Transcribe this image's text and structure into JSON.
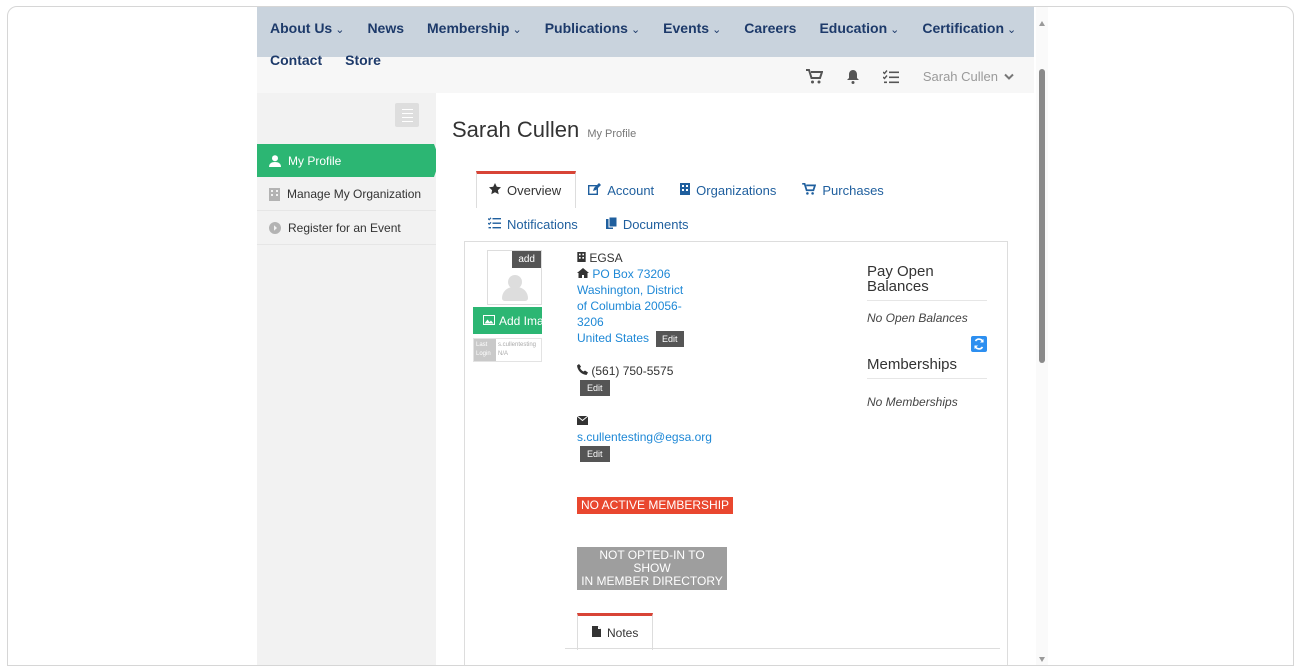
{
  "nav": {
    "row1": [
      {
        "label": "About Us",
        "dropdown": true
      },
      {
        "label": "News",
        "dropdown": false
      },
      {
        "label": "Membership",
        "dropdown": true
      },
      {
        "label": "Publications",
        "dropdown": true
      },
      {
        "label": "Events",
        "dropdown": true
      },
      {
        "label": "Careers",
        "dropdown": false
      },
      {
        "label": "Education",
        "dropdown": true
      },
      {
        "label": "Certification",
        "dropdown": true
      }
    ],
    "row2": [
      {
        "label": "Contact"
      },
      {
        "label": "Store"
      }
    ],
    "chevron": "⌄"
  },
  "toolbar": {
    "user_name": "Sarah Cullen",
    "icons": [
      "cart-icon",
      "bell-icon",
      "tasks-icon",
      "chevron-down-icon"
    ]
  },
  "sidebar": {
    "items": [
      {
        "label": "My Profile",
        "icon": "user-icon",
        "active": true
      },
      {
        "label": "Manage My Organization",
        "icon": "building-icon",
        "active": false
      },
      {
        "label": "Register for an Event",
        "icon": "arrow-circle-icon",
        "active": false
      }
    ]
  },
  "profile": {
    "name": "Sarah Cullen",
    "subtitle": "My Profile",
    "tabs_row1": [
      {
        "label": "Overview",
        "icon": "star-icon"
      },
      {
        "label": "Account",
        "icon": "edit-icon"
      },
      {
        "label": "Organizations",
        "icon": "building-icon"
      },
      {
        "label": "Purchases",
        "icon": "cart-icon"
      }
    ],
    "tabs_row2": [
      {
        "label": "Notifications",
        "icon": "list-icon"
      },
      {
        "label": "Documents",
        "icon": "documents-icon"
      }
    ],
    "avatar_add": "add",
    "add_image": "Add Image",
    "last_login_label": "Last Login",
    "last_login_user": "s.cullentesting",
    "last_login_value": "N/A",
    "org": "EGSA",
    "address_lines": [
      "PO Box 73206",
      "Washington, District",
      "of Columbia 20056-",
      "3206",
      "United States"
    ],
    "phone": "(561) 750-5575",
    "email": "s.cullentesting@egsa.org",
    "edit_label": "Edit",
    "badge_membership": "NO ACTIVE MEMBERSHIP",
    "badge_directory_1": "NOT OPTED-IN TO SHOW",
    "badge_directory_2": "IN MEMBER DIRECTORY",
    "pay_open_title_1": "Pay Open",
    "pay_open_title_2": "Balances",
    "no_open_balances": "No Open Balances",
    "memberships_title": "Memberships",
    "no_memberships": "No Memberships",
    "notes_tab": "Notes"
  },
  "colors": {
    "accent_green": "#2cb673",
    "nav_bg": "#c9d3dd",
    "link_blue": "#1e88d6",
    "tab_active_border": "#d84436",
    "badge_red": "#e9472f"
  }
}
